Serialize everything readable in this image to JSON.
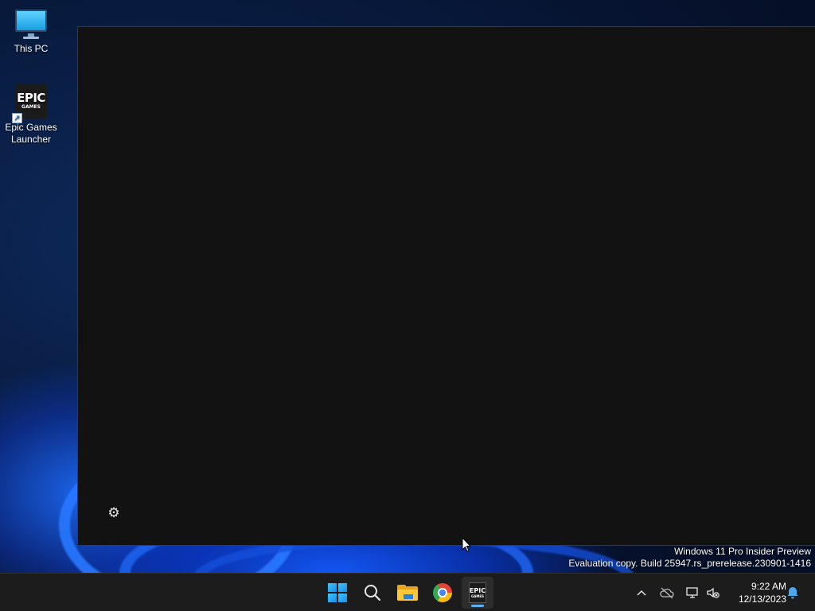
{
  "desktop": {
    "icons": [
      {
        "label": "This PC",
        "icon": "monitor-icon"
      },
      {
        "label": "Epic Games Launcher",
        "icon": "epic-games-icon",
        "logo_line1": "EPIC",
        "logo_line2": "GAMES"
      }
    ]
  },
  "app_window": {
    "background": "#121212",
    "settings_icon": "gear-icon"
  },
  "watermark": {
    "line1": "Windows 11 Pro Insider Preview",
    "line2": "Evaluation copy. Build 25947.rs_prerelease.230901-1416"
  },
  "taskbar": {
    "pinned": [
      {
        "name": "start",
        "icon": "windows-icon"
      },
      {
        "name": "search",
        "icon": "search-icon"
      },
      {
        "name": "file-explorer",
        "icon": "folder-icon"
      },
      {
        "name": "chrome",
        "icon": "chrome-icon"
      },
      {
        "name": "epic-games-launcher",
        "icon": "epic-games-icon",
        "active": true,
        "logo_line1": "EPIC",
        "logo_line2": "GAMES"
      }
    ],
    "tray": {
      "icons": [
        "chevron-up-icon",
        "cloud-off-icon",
        "network-icon",
        "volume-muted-icon"
      ],
      "time": "9:22 AM",
      "date": "12/13/2023",
      "notification_icon": "bell-icon"
    },
    "accent_color": "#5fb2f2"
  }
}
